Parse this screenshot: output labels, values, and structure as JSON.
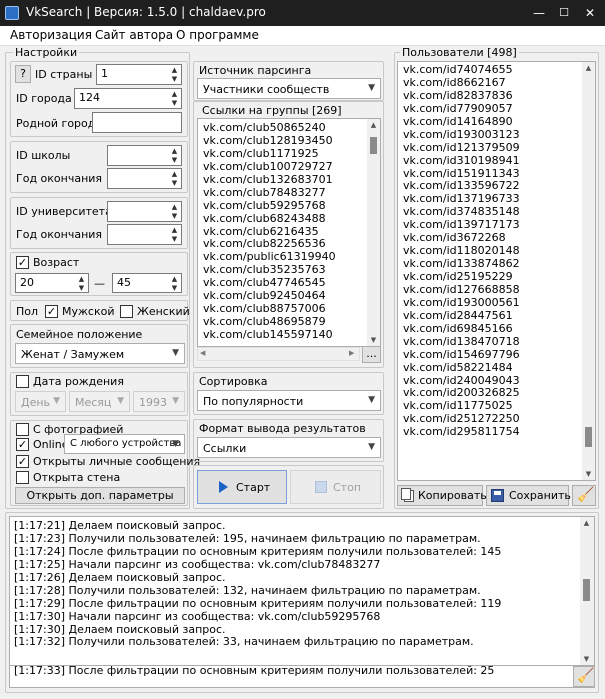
{
  "window": {
    "title": "VkSearch | Версия: 1.5.0 | chaldaev.pro",
    "min": "—",
    "max": "☐",
    "close": "✕"
  },
  "menu": {
    "auth": "Авторизация",
    "site": "Сайт автора",
    "about": "О программе"
  },
  "settings": {
    "title": "Настройки",
    "help": "?",
    "country_label": "ID страны",
    "country_value": "1",
    "city_label": "ID города",
    "city_value": "124",
    "hometown_label": "Родной город",
    "hometown_value": "",
    "school_label": "ID школы",
    "school_value": "",
    "school_year_label": "Год окончания",
    "school_year_value": "",
    "univ_label": "ID университета",
    "univ_value": "",
    "univ_year_label": "Год окончания",
    "univ_year_value": "",
    "age_label": "Возраст",
    "age_checked": true,
    "age_from": "20",
    "age_dash": "—",
    "age_to": "45",
    "sex_label": "Пол",
    "male_label": "Мужской",
    "male_checked": true,
    "female_label": "Женский",
    "female_checked": false,
    "family_label": "Семейное положение",
    "family_value": "Женат / Замужем",
    "birth_label": "Дата рождения",
    "birth_checked": false,
    "day": "День",
    "month": "Месяц",
    "year": "1993",
    "photo_label": "С фотографией",
    "photo_checked": false,
    "online_label": "Online",
    "online_checked": true,
    "device_value": "С любого устройства",
    "pm_label": "Открыты личные сообщения",
    "pm_checked": true,
    "wall_label": "Открыта стена",
    "wall_checked": false,
    "extra_button": "Открыть доп. параметры"
  },
  "source": {
    "title": "Источник парсинга",
    "value": "Участники сообществ"
  },
  "groups": {
    "title": "Ссылки на группы [269]",
    "more": "...",
    "items": [
      "vk.com/club50865240",
      "vk.com/club128193450",
      "vk.com/club1171925",
      "vk.com/club100729727",
      "vk.com/club132683701",
      "vk.com/club78483277",
      "vk.com/club59295768",
      "vk.com/club68243488",
      "vk.com/club6216435",
      "vk.com/club82256536",
      "vk.com/public61319940",
      "vk.com/club35235763",
      "vk.com/club47746545",
      "vk.com/club92450464",
      "vk.com/club88757006",
      "vk.com/club48695879",
      "vk.com/club145597140"
    ]
  },
  "sort": {
    "title": "Сортировка",
    "value": "По популярности"
  },
  "output": {
    "title": "Формат вывода результатов",
    "value": "Ссылки"
  },
  "controls": {
    "start": "Старт",
    "stop": "Стоп"
  },
  "users": {
    "title": "Пользователи [498]",
    "copy": "Копировать",
    "save": "Сохранить",
    "items": [
      "vk.com/id74074655",
      "vk.com/id8662167",
      "vk.com/id82837836",
      "vk.com/id77909057",
      "vk.com/id14164890",
      "vk.com/id193003123",
      "vk.com/id121379509",
      "vk.com/id310198941",
      "vk.com/id151911343",
      "vk.com/id133596722",
      "vk.com/id137196733",
      "vk.com/id374835148",
      "vk.com/id139717173",
      "vk.com/id3672268",
      "vk.com/id118020148",
      "vk.com/id133874862",
      "vk.com/id25195229",
      "vk.com/id127668858",
      "vk.com/id193000561",
      "vk.com/id28447561",
      "vk.com/id69845166",
      "vk.com/id138470718",
      "vk.com/id154697796",
      "vk.com/id58221484",
      "vk.com/id240049043",
      "vk.com/id200326825",
      "vk.com/id11775025",
      "vk.com/id251272250",
      "vk.com/id295811754"
    ]
  },
  "log": [
    "[1:17:21] Делаем поисковый запрос.",
    "[1:17:23] Получили пользователей: 195, начинаем фильтрацию по параметрам.",
    "[1:17:24] После фильтрации по основным критериям получили пользователей: 145",
    "[1:17:25] Начали парсинг из сообщества: vk.com/club78483277",
    "[1:17:26] Делаем поисковый запрос.",
    "[1:17:28] Получили пользователей: 132, начинаем фильтрацию по параметрам.",
    "[1:17:29] После фильтрации по основным критериям получили пользователей: 119",
    "[1:17:30] Начали парсинг из сообщества: vk.com/club59295768",
    "[1:17:30] Делаем поисковый запрос.",
    "[1:17:32] Получили пользователей: 33, начинаем фильтрацию по параметрам.",
    "[1:17:33] После фильтрации по основным критериям получили пользователей: 25"
  ]
}
